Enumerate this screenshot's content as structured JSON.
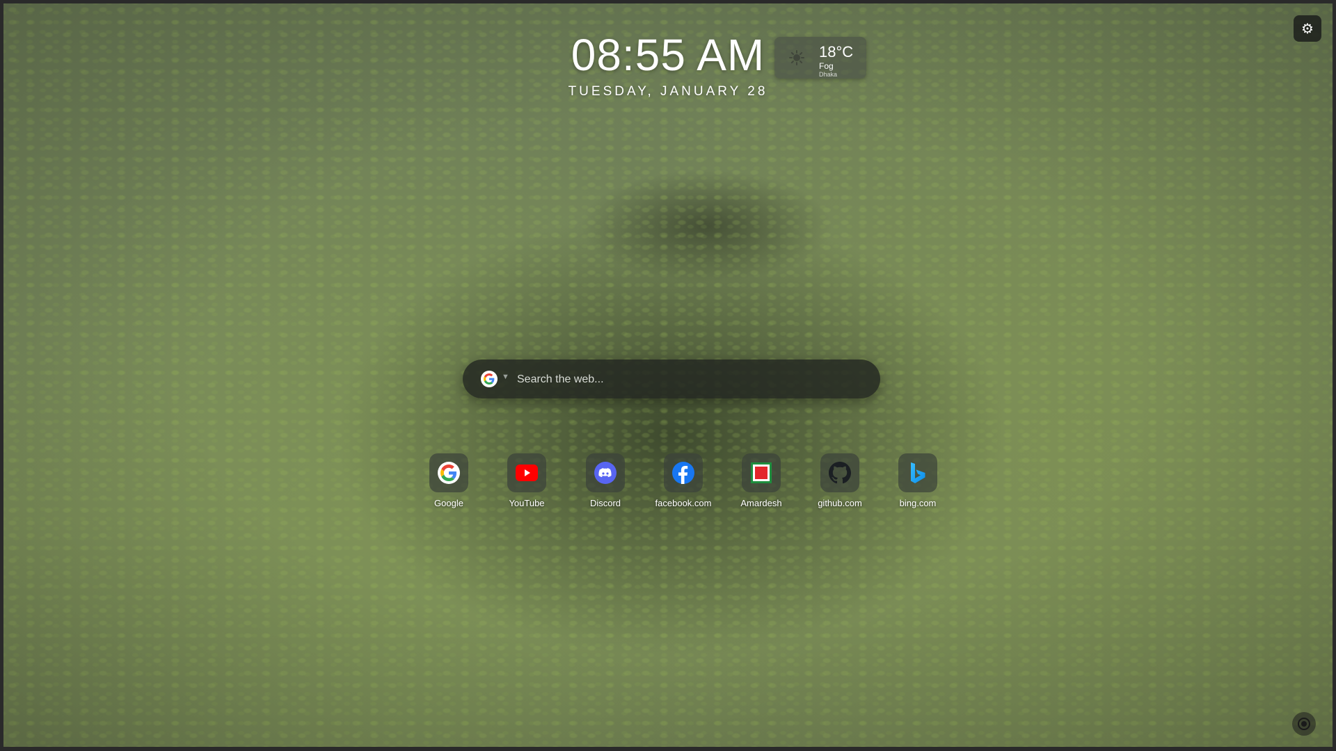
{
  "clock": {
    "time": "08:55 AM",
    "date": "TUESDAY, JANUARY 28"
  },
  "weather": {
    "temperature": "18°C",
    "condition": "Fog",
    "city": "Dhaka",
    "icon": "fog-icon"
  },
  "settings": {
    "icon": "gear-icon",
    "glyph": "⚙"
  },
  "search": {
    "placeholder": "Search the web...",
    "value": "",
    "engine_icon": "google-icon",
    "caret": "▼"
  },
  "shortcuts": [
    {
      "label": "Google",
      "icon": "google-icon"
    },
    {
      "label": "YouTube",
      "icon": "youtube-icon"
    },
    {
      "label": "Discord",
      "icon": "discord-icon"
    },
    {
      "label": "facebook.com",
      "icon": "facebook-icon"
    },
    {
      "label": "Amardesh",
      "icon": "amardesh-icon"
    },
    {
      "label": "github.com",
      "icon": "github-icon"
    },
    {
      "label": "bing.com",
      "icon": "bing-icon"
    }
  ],
  "colors": {
    "youtube": "#FF0000",
    "discord": "#5865F2",
    "facebook": "#1877F2",
    "amardesh_red": "#E3262B",
    "amardesh_green": "#1E8E3E",
    "bing": "#0C8CE9"
  }
}
